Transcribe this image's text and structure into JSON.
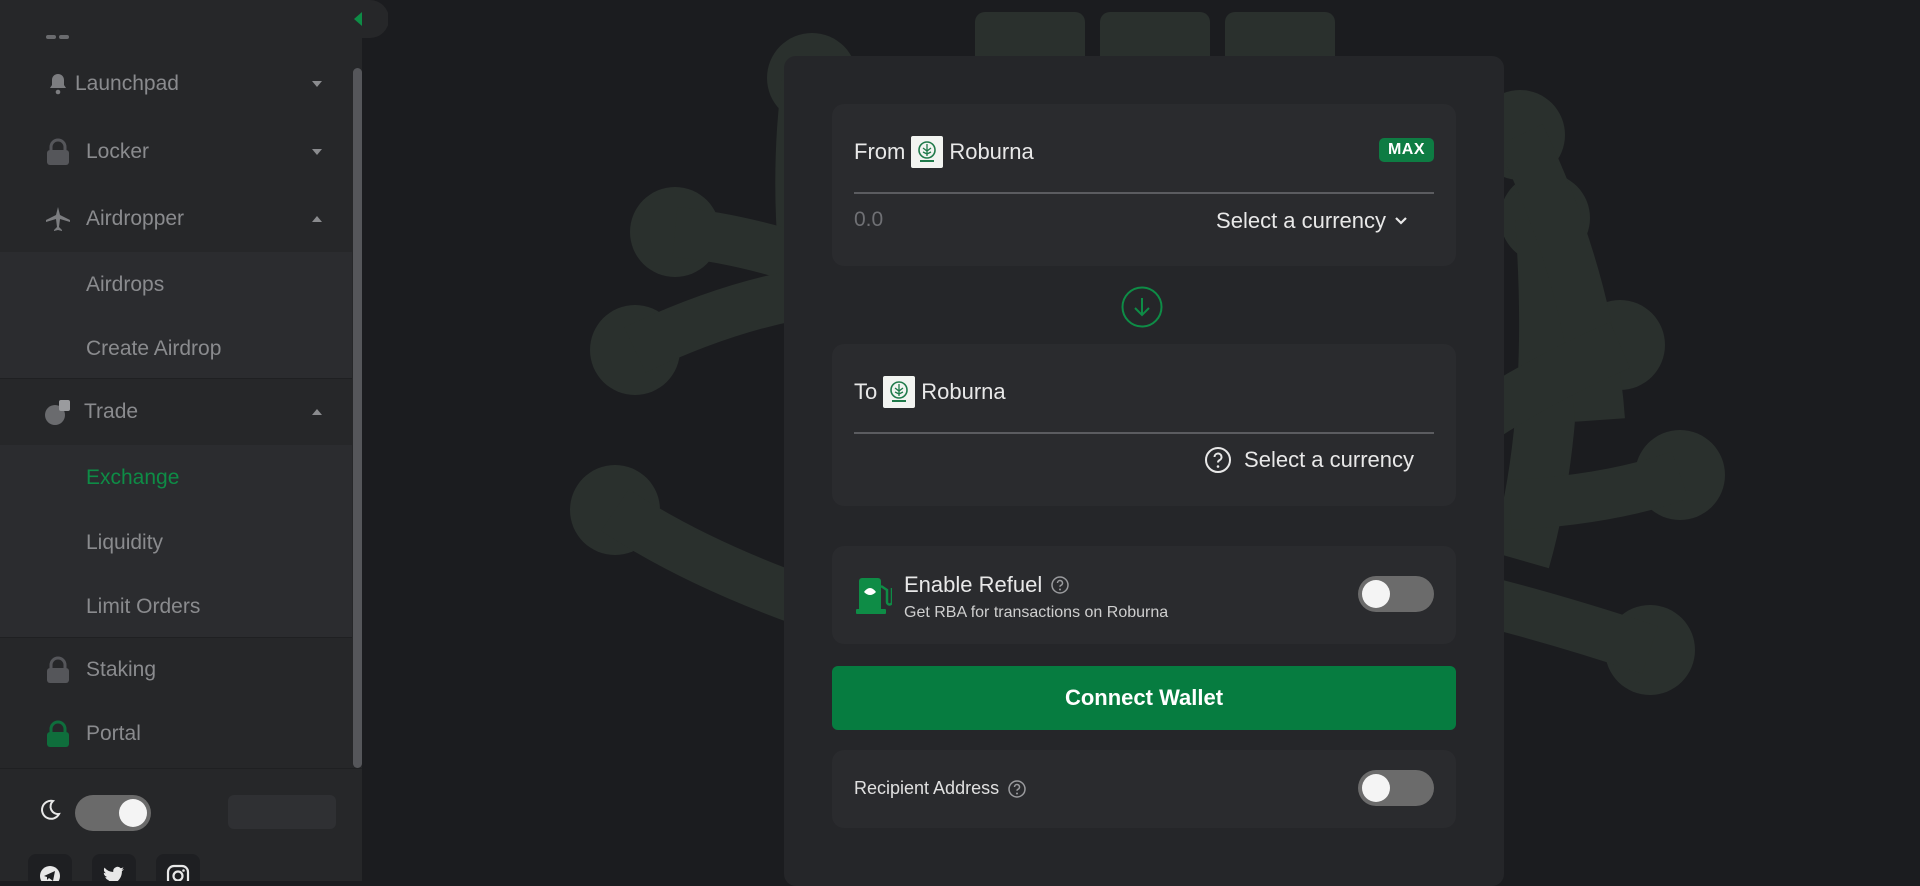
{
  "sidebar": {
    "items": [
      {
        "label": "Launchpad",
        "icon": "bell-icon",
        "expanded": false
      },
      {
        "label": "Locker",
        "icon": "lock-icon",
        "expanded": false
      },
      {
        "label": "Airdropper",
        "icon": "plane-icon",
        "expanded": true,
        "children": [
          {
            "label": "Airdrops"
          },
          {
            "label": "Create Airdrop"
          }
        ]
      },
      {
        "label": "Trade",
        "icon": "trade-icon",
        "expanded": true,
        "children": [
          {
            "label": "Exchange",
            "active": true
          },
          {
            "label": "Liquidity"
          },
          {
            "label": "Limit Orders"
          }
        ]
      },
      {
        "label": "Staking",
        "icon": "lock-icon"
      },
      {
        "label": "Portal",
        "icon": "lock-icon"
      }
    ],
    "theme_mode": "dark",
    "socials": [
      "telegram-icon",
      "twitter-icon",
      "instagram-icon"
    ]
  },
  "exchange": {
    "from": {
      "label": "From",
      "token_name": "Roburna",
      "max_label": "MAX",
      "amount_placeholder": "0.0",
      "currency_label": "Select a currency"
    },
    "to": {
      "label": "To",
      "token_name": "Roburna",
      "currency_label": "Select a currency"
    },
    "refuel": {
      "title": "Enable Refuel",
      "subtitle": "Get RBA for transactions on Roburna",
      "enabled": false
    },
    "connect_label": "Connect Wallet",
    "recipient": {
      "label": "Recipient Address",
      "enabled": false
    }
  },
  "colors": {
    "accent": "#067c40",
    "active_text": "#0e8c46",
    "background": "#1b1c1f",
    "sidebar": "#262729",
    "card": "#252629",
    "panel": "#2a2b2e"
  }
}
